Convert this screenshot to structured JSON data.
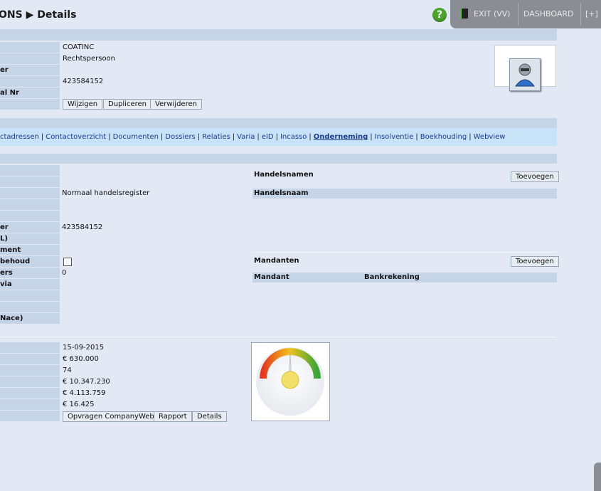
{
  "header": {
    "title": "ONS ▶ Details",
    "nav": {
      "exit": "EXIT (VV)",
      "dashboard": "DASHBOARD",
      "plus": "[+]"
    },
    "help": "?"
  },
  "record": {
    "labels": [
      "",
      "",
      "er",
      "",
      "al Nr",
      ""
    ],
    "values": [
      "COATINC",
      "Rechtspersoon",
      "",
      "423584152",
      "",
      ""
    ],
    "buttons": {
      "edit": "Wijzigen",
      "duplicate": "Dupliceren",
      "delete": "Verwijderen"
    }
  },
  "tabs": [
    {
      "label": "ctadressen",
      "active": false
    },
    {
      "label": "Contactoverzicht",
      "active": false
    },
    {
      "label": "Documenten",
      "active": false
    },
    {
      "label": "Dossiers",
      "active": false
    },
    {
      "label": "Relaties",
      "active": false
    },
    {
      "label": "Varia",
      "active": false
    },
    {
      "label": "eID",
      "active": false
    },
    {
      "label": "Incasso",
      "active": false
    },
    {
      "label": "Onderneming",
      "active": true
    },
    {
      "label": "Insolventie",
      "active": false
    },
    {
      "label": "Boekhouding",
      "active": false
    },
    {
      "label": "Webview",
      "active": false
    }
  ],
  "company": {
    "labels": [
      "",
      "",
      "",
      "",
      "",
      "er",
      "L)",
      "ment",
      "behoud",
      "ers",
      "via",
      "",
      "",
      "Nace)"
    ],
    "values": [
      "",
      "",
      "Normaal handelsregister",
      "",
      "",
      "423584152",
      "",
      "",
      "",
      "0",
      "",
      "",
      "",
      ""
    ]
  },
  "trade_names": {
    "title": "Handelsnamen",
    "add": "Toevoegen",
    "column": "Handelsnaam"
  },
  "mandates": {
    "title": "Mandanten",
    "add": "Toevoegen",
    "col_mandant": "Mandant",
    "col_account": "Bankrekening"
  },
  "finance": {
    "values": [
      "15-09-2015",
      "€ 630.000",
      "74",
      "€ 10.347.230",
      "€ 4.113.759",
      "€ 16.425"
    ],
    "buttons": {
      "companyweb": "Opvragen CompanyWeb",
      "report": "Rapport",
      "details": "Details"
    }
  },
  "gauge": {
    "score_fraction": 0.5,
    "colors": {
      "low": "#e23a22",
      "mid": "#f2c21a",
      "high": "#3aa63a",
      "needle": "#f3e06a"
    }
  }
}
